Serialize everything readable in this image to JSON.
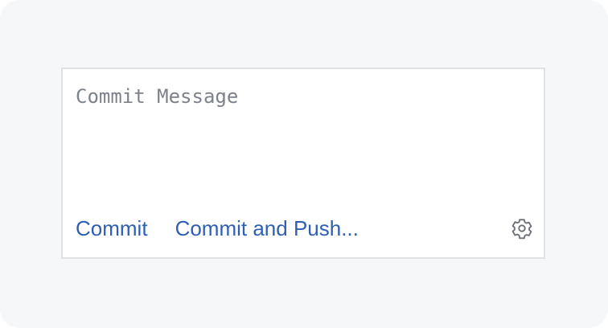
{
  "commit_panel": {
    "message_placeholder": "Commit Message",
    "message_value": "",
    "commit_label": "Commit",
    "commit_and_push_label": "Commit and Push...",
    "settings_icon": "gear-icon"
  },
  "colors": {
    "background": "#f6f7f9",
    "panel_border": "#dfe1e5",
    "link": "#2f5fb3",
    "placeholder": "#7d828a",
    "icon": "#6b7079"
  }
}
